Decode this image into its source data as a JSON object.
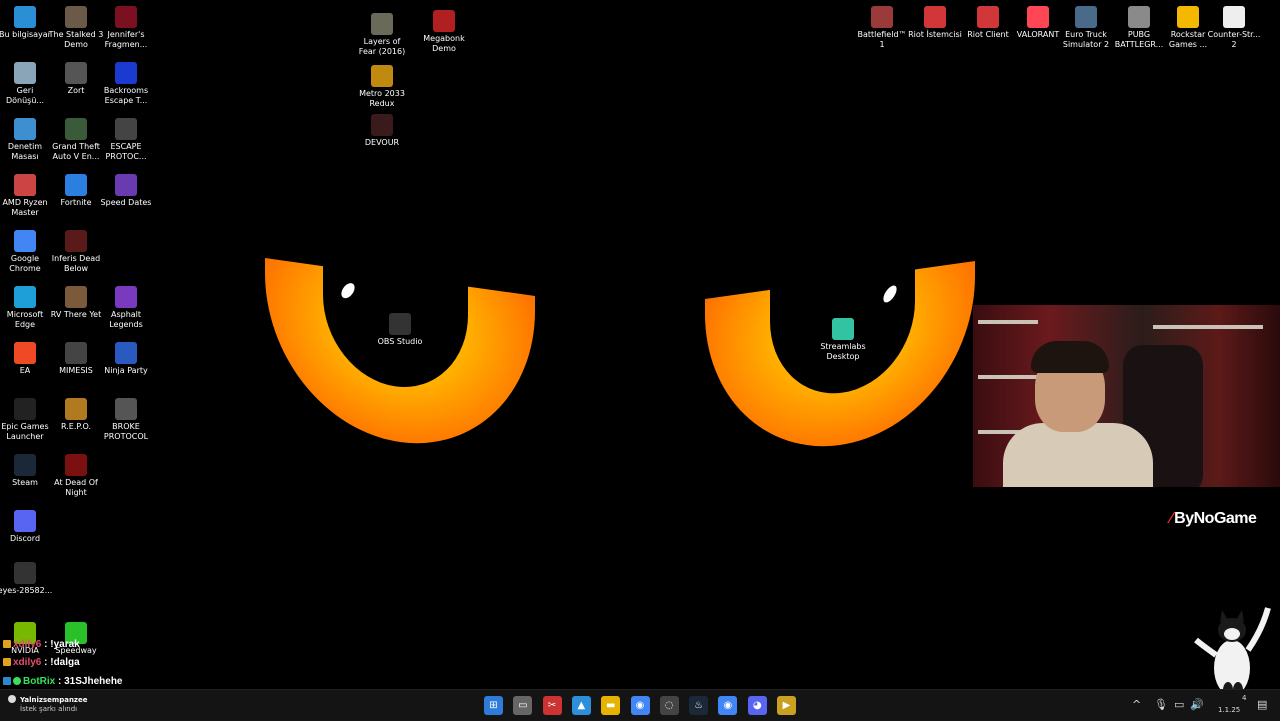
{
  "desktop": {
    "col1": [
      {
        "label": "Bu bilgisayar",
        "icon": "computer-icon",
        "color": "#2b8fd6"
      },
      {
        "label": "Geri Dönüşü...",
        "icon": "recycle-bin-icon",
        "color": "#8aa4b8"
      },
      {
        "label": "Denetim Masası",
        "icon": "control-panel-icon",
        "color": "#3c8fd0"
      },
      {
        "label": "AMD Ryzen Master",
        "icon": "amd-ryzen-icon",
        "color": "#c44"
      },
      {
        "label": "Google Chrome",
        "icon": "chrome-icon",
        "color": "#4285f4"
      },
      {
        "label": "Microsoft Edge",
        "icon": "edge-icon",
        "color": "#1f9fd8"
      },
      {
        "label": "EA",
        "icon": "ea-icon",
        "color": "#f04a24"
      },
      {
        "label": "Epic Games Launcher",
        "icon": "epic-games-icon",
        "color": "#222"
      },
      {
        "label": "Steam",
        "icon": "steam-icon",
        "color": "#1b2838"
      },
      {
        "label": "Discord",
        "icon": "discord-icon",
        "color": "#5865f2"
      },
      {
        "label": "eyes-28582...",
        "icon": "file-icon",
        "color": "#333"
      }
    ],
    "col2": [
      {
        "label": "The Stalked 3 Demo",
        "icon": "game-stalked-icon",
        "color": "#6b5a48"
      },
      {
        "label": "Zort",
        "icon": "game-zort-icon",
        "color": "#555"
      },
      {
        "label": "Grand Theft Auto V En...",
        "icon": "gta-icon",
        "color": "#3a5a3a"
      },
      {
        "label": "Fortnite",
        "icon": "fortnite-icon",
        "color": "#2a7fe0"
      },
      {
        "label": "Inferis Dead Below",
        "icon": "game-inferis-icon",
        "color": "#5a1a1a"
      },
      {
        "label": "RV There Yet",
        "icon": "game-rv-icon",
        "color": "#7a5a3a"
      },
      {
        "label": "MIMESIS",
        "icon": "game-mimesis-icon",
        "color": "#444"
      },
      {
        "label": "R.E.P.O.",
        "icon": "game-repo-icon",
        "color": "#b07a20"
      },
      {
        "label": "At Dead Of Night",
        "icon": "game-adon-icon",
        "color": "#7a1010"
      }
    ],
    "col3": [
      {
        "label": "Jennifer's Fragmen...",
        "icon": "game-jennifer-icon",
        "color": "#7a1020"
      },
      {
        "label": "Backrooms Escape T...",
        "icon": "game-backrooms-icon",
        "color": "#1a3ad0"
      },
      {
        "label": "ESCAPE PROTOC...",
        "icon": "game-escape-icon",
        "color": "#444"
      },
      {
        "label": "Speed Dates",
        "icon": "game-speeddates-icon",
        "color": "#6a3ab0"
      },
      {
        "label": "Asphalt Legends",
        "icon": "asphalt-icon",
        "color": "#7a3ac0"
      },
      {
        "label": "Ninja Party",
        "icon": "game-ninja-icon",
        "color": "#2a5ac0"
      },
      {
        "label": "BROKE PROTOCOL",
        "icon": "game-broke-icon",
        "color": "#555"
      }
    ],
    "center": [
      {
        "label": "Layers of Fear (2016)",
        "icon": "game-layers-icon",
        "color": "#6a6a5a"
      },
      {
        "label": "Megabonk Demo",
        "icon": "game-megabonk-icon",
        "color": "#b02020"
      },
      {
        "label": "Metro 2033 Redux",
        "icon": "metro-icon",
        "color": "#c08a10"
      },
      {
        "label": "DEVOUR",
        "icon": "devour-icon",
        "color": "#3a1a1a"
      },
      {
        "label": "OBS Studio",
        "icon": "obs-icon",
        "color": "#333"
      },
      {
        "label": "Streamlabs Desktop",
        "icon": "streamlabs-icon",
        "color": "#31c3a2"
      }
    ],
    "right": [
      {
        "label": "Battlefield™ 1",
        "icon": "battlefield-icon",
        "color": "#9a3a3a"
      },
      {
        "label": "Riot İstemcisi",
        "icon": "riot-icon",
        "color": "#d13639"
      },
      {
        "label": "Riot Client",
        "icon": "riot-icon",
        "color": "#d13639"
      },
      {
        "label": "VALORANT",
        "icon": "valorant-icon",
        "color": "#ff4655"
      },
      {
        "label": "Euro Truck Simulator 2",
        "icon": "ets2-icon",
        "color": "#4a6a8a"
      },
      {
        "label": "PUBG BATTLEGR...",
        "icon": "pubg-icon",
        "color": "#8a8a8a"
      },
      {
        "label": "Rockstar Games ...",
        "icon": "rockstar-icon",
        "color": "#f5b800"
      },
      {
        "label": "Counter-Str... 2",
        "icon": "file-icon",
        "color": "#eeeeee"
      }
    ],
    "bottom": [
      {
        "label": "NVIDIA",
        "icon": "nvidia-icon",
        "color": "#76b900"
      },
      {
        "label": "Speedway",
        "icon": "speedway-icon",
        "color": "#2ac02a"
      }
    ]
  },
  "overlay": {
    "brand": "ByNoGame",
    "chat": [
      {
        "user": "xdily6",
        "text": " : !yarak",
        "color": "#e0506a"
      },
      {
        "user": "xdily6",
        "text": " : !dalga",
        "color": "#e0506a"
      },
      {
        "user": "BotRix",
        "text": " : 31SJhehehe",
        "color": "#3ae05a"
      }
    ]
  },
  "taskbar": {
    "now_playing_title": "Yalnizsempanzee",
    "now_playing_sub": "İstek şarkı alındı",
    "apps": [
      "windows-start-icon",
      "task-view-icon",
      "snipping-tool-icon",
      "photos-icon",
      "file-explorer-icon",
      "chrome-icon",
      "obs-icon",
      "steam-icon",
      "chrome-alt-icon",
      "discord-icon",
      "media-player-icon"
    ],
    "tray": {
      "chevron": "^",
      "clock_time": "4",
      "clock_date": "1.1.25"
    }
  }
}
